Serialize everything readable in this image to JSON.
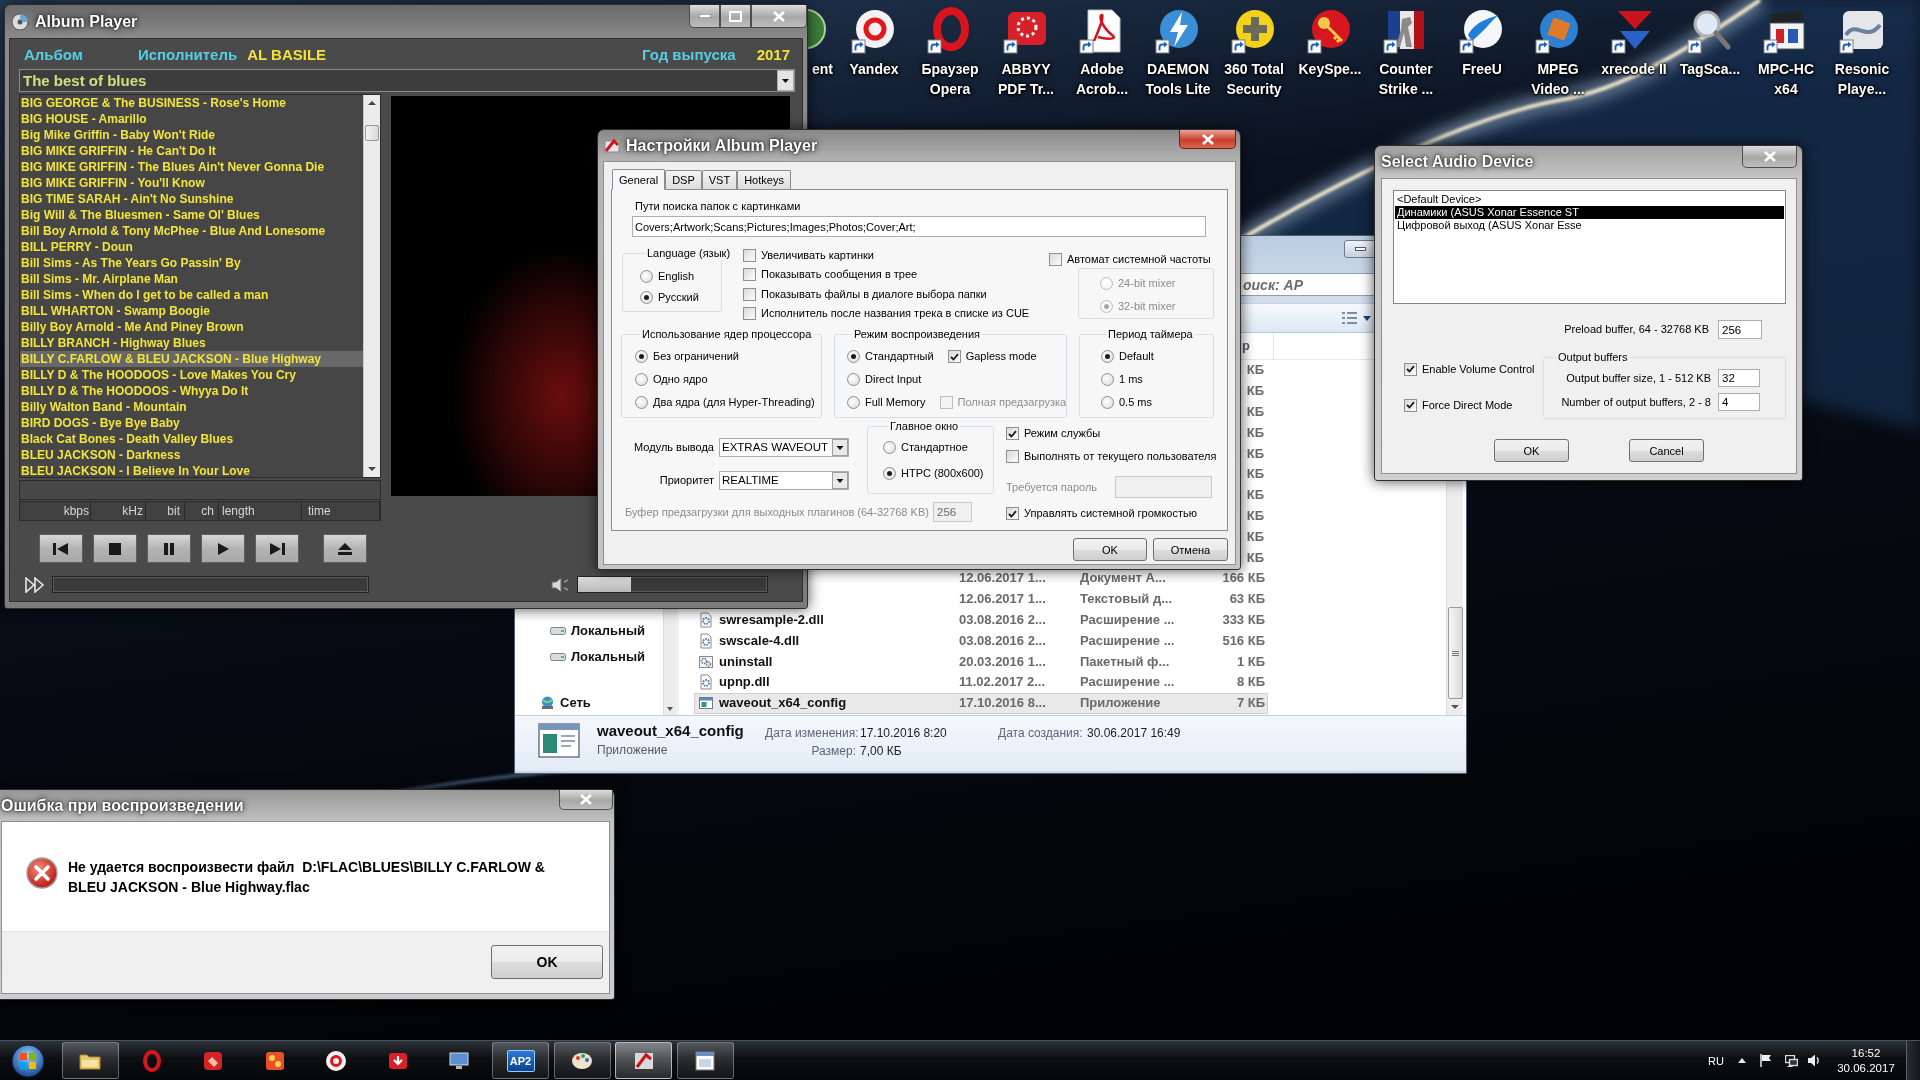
{
  "album_player": {
    "title": "Album Player",
    "album_label": "Альбом",
    "artist_label": "Исполнитель",
    "artist": "AL BASILE",
    "year_label": "Год выпуска",
    "year": "2017",
    "album": "The best of blues",
    "tracks": [
      {
        "title": "BIG GEORGE & The BUSINESS - Rose's Home",
        "selected": false
      },
      {
        "title": "BIG HOUSE - Amarillo",
        "selected": false
      },
      {
        "title": "Big Mike Griffin - Baby Won't Ride",
        "selected": false
      },
      {
        "title": "BIG MIKE GRIFFIN - He Can't Do It",
        "selected": false
      },
      {
        "title": "BIG MIKE GRIFFIN - The Blues Ain't Never Gonna Die",
        "selected": false
      },
      {
        "title": "BIG MIKE GRIFFIN - You'll Know",
        "selected": false
      },
      {
        "title": "BIG TIME SARAH - Ain't No Sunshine",
        "selected": false
      },
      {
        "title": "Big Will & The Bluesmen - Same Ol' Blues",
        "selected": false
      },
      {
        "title": "Bill Boy Arnold & Tony McPhee - Blue And Lonesome",
        "selected": false
      },
      {
        "title": "BILL PERRY - Doun",
        "selected": false
      },
      {
        "title": "Bill Sims - As The Years Go Passin' By",
        "selected": false
      },
      {
        "title": "Bill Sims - Mr. Airplane Man",
        "selected": false
      },
      {
        "title": "Bill Sims - When do I get to be called a man",
        "selected": false
      },
      {
        "title": "BILL WHARTON - Swamp Boogie",
        "selected": false
      },
      {
        "title": "Billy Boy Arnold - Me And Piney Brown",
        "selected": false
      },
      {
        "title": "BILLY BRANCH - Highway Blues",
        "selected": false
      },
      {
        "title": "BILLY C.FARLOW & BLEU JACKSON - Blue Highway",
        "selected": true
      },
      {
        "title": "BILLY D & The HOODOOS - Love Makes You Cry",
        "selected": false
      },
      {
        "title": "BILLY D & The HOODOOS - Whyya Do It",
        "selected": false
      },
      {
        "title": "Billy Walton Band - Mountain",
        "selected": false
      },
      {
        "title": "BIRD DOGS - Bye Bye Baby",
        "selected": false
      },
      {
        "title": "Black Cat Bones - Death Valley Blues",
        "selected": false
      },
      {
        "title": "BLEU JACKSON - Darkness",
        "selected": false
      },
      {
        "title": "BLEU JACKSON - I Believe In Your Love",
        "selected": false
      }
    ],
    "columns": [
      "kbps",
      "kHz",
      "bit",
      "ch",
      "length",
      "time"
    ],
    "volume": {
      "level": 0.28
    }
  },
  "desktop": {
    "icons": [
      {
        "kind": "partial",
        "label": "ent"
      },
      {
        "kind": "yandex",
        "label": "Yandex"
      },
      {
        "kind": "opera",
        "label": "Браузер\nOpera"
      },
      {
        "kind": "abbyy",
        "label": "ABBYY\nPDF Tr..."
      },
      {
        "kind": "acrobat",
        "label": "Adobe\nAcrob..."
      },
      {
        "kind": "daemon",
        "label": "DAEMON\nTools Lite"
      },
      {
        "kind": "security",
        "label": "360 Total\nSecurity"
      },
      {
        "kind": "keyspeed",
        "label": "KeySpe..."
      },
      {
        "kind": "counterstrike",
        "label": "Counter\nStrike ..."
      },
      {
        "kind": "freeu",
        "label": "FreeU"
      },
      {
        "kind": "mpeg",
        "label": "MPEG\nVideo ..."
      },
      {
        "kind": "xrecode",
        "label": "xrecode II"
      },
      {
        "kind": "tagscanner",
        "label": "TagSca..."
      },
      {
        "kind": "mpchc",
        "label": "MPC-HC\nx64"
      },
      {
        "kind": "resonic",
        "label": "Resonic\nPlaye..."
      }
    ]
  },
  "settings": {
    "title": "Настройки Album Player",
    "tabs": [
      {
        "label": "General",
        "selected": true
      },
      {
        "label": "DSP",
        "selected": false
      },
      {
        "label": "VST",
        "selected": false
      },
      {
        "label": "Hotkeys",
        "selected": false
      }
    ],
    "paths": {
      "label": "Пути поиска папок с картинками",
      "value": "Covers;Artwork;Scans;Pictures;Images;Photos;Cover;Art;"
    },
    "language": {
      "title": "Language (язык)",
      "options": [
        {
          "label": "English",
          "selected": false
        },
        {
          "label": "Русский",
          "selected": true
        }
      ]
    },
    "options": [
      {
        "label": "Увеличивать картинки",
        "checked": false
      },
      {
        "label": "Показывать сообщения в трее",
        "checked": false
      },
      {
        "label": "Показывать файлы в диалоге выбора папки",
        "checked": false
      },
      {
        "label": "Исполнитель после названия трека в списке из CUE",
        "checked": false
      }
    ],
    "auto_frequency": {
      "label": "Автомат системной частоты",
      "checked": false
    },
    "mixer": {
      "disabled": true,
      "options": [
        {
          "label": "24-bit mixer",
          "selected": false
        },
        {
          "label": "32-bit mixer",
          "selected": true
        }
      ]
    },
    "cpu": {
      "title": "Использование ядер процессора",
      "options": [
        {
          "label": "Без ограничений",
          "selected": true
        },
        {
          "label": "Одно ядро",
          "selected": false
        },
        {
          "label": "Два ядра (для Hyper-Threading)",
          "selected": false
        }
      ]
    },
    "playback": {
      "title": "Режим воспроизведения",
      "options": [
        {
          "label": "Стандартный",
          "selected": true,
          "extra": {
            "label": "Gapless mode",
            "checked": true,
            "disabled": false
          }
        },
        {
          "label": "Direct Input",
          "selected": false
        },
        {
          "label": "Full Memory",
          "selected": false,
          "extra": {
            "label": "Полная предзагрузка",
            "checked": false,
            "disabled": true
          }
        }
      ]
    },
    "timer": {
      "title": "Период таймера",
      "options": [
        {
          "label": "Default",
          "selected": true
        },
        {
          "label": "1 ms",
          "selected": false
        },
        {
          "label": "0.5 ms",
          "selected": false
        }
      ]
    },
    "output_module": {
      "label": "Модуль вывода",
      "value": "EXTRAS WAVEOUT"
    },
    "priority": {
      "label": "Приоритет",
      "value": "REALTIME"
    },
    "main_window": {
      "title": "Главное окно",
      "options": [
        {
          "label": "Стандартное",
          "selected": false
        },
        {
          "label": "HTPC (800x600)",
          "selected": true
        }
      ]
    },
    "service": [
      {
        "label": "Режим службы",
        "checked": true
      },
      {
        "label": "Выполнять от текущего пользователя",
        "checked": false
      }
    ],
    "password": {
      "label": "Требуется пароль",
      "disabled": true
    },
    "buffer": {
      "label": "Буфер предзагрузки для выходных плагинов (64-32768 KB)",
      "value": "256",
      "disabled": true
    },
    "system_volume": {
      "label": "Управлять системной громкостью",
      "checked": true
    },
    "buttons": [
      "OK",
      "Отмена"
    ]
  },
  "audio_device": {
    "title": "Select Audio Device",
    "devices": [
      {
        "label": "<Default Device>",
        "selected": false
      },
      {
        "label": "Динамики (ASUS Xonar Essence ST",
        "selected": true
      },
      {
        "label": "Цифровой выход (ASUS Xonar Esse",
        "selected": false
      }
    ],
    "preload": {
      "label": "Preload buffer, 64 - 32768 KB",
      "value": "256"
    },
    "checks": [
      {
        "label": "Enable Volume Control",
        "checked": true
      },
      {
        "label": "Force Direct Mode",
        "checked": true
      }
    ],
    "output_buffers": {
      "title": "Output buffers",
      "fields": [
        {
          "label": "Output buffer size, 1 - 512 KB",
          "value": "32"
        },
        {
          "label": "Number of output buffers, 2 - 8",
          "value": "4"
        }
      ]
    },
    "buttons": [
      "OK",
      "Cancel"
    ]
  },
  "explorer": {
    "search": {
      "placeholder": "оиск: AP"
    },
    "size_header": "р",
    "nav": [
      {
        "kind": "drive",
        "label": "Локальный"
      },
      {
        "kind": "drive",
        "label": "Локальный"
      },
      {
        "kind": "network",
        "label": "Сеть"
      }
    ],
    "hidden_sizes": [
      "КБ",
      "КБ",
      "КБ",
      "КБ",
      "КБ",
      "КБ",
      "КБ",
      "КБ",
      "КБ",
      "КБ"
    ],
    "files": [
      {
        "date": "12.06.2017 1...",
        "type": "Документ А...",
        "size": "166 КБ",
        "selected": false
      },
      {
        "date": "12.06.2017 1...",
        "type": "Текстовый д...",
        "size": "63 КБ",
        "selected": false
      },
      {
        "kind": "dll",
        "name": "swresample-2.dll",
        "date": "03.08.2016 2...",
        "type": "Расширение ...",
        "size": "333 КБ",
        "selected": false
      },
      {
        "kind": "dll",
        "name": "swscale-4.dll",
        "date": "03.08.2016 2...",
        "type": "Расширение ...",
        "size": "516 КБ",
        "selected": false
      },
      {
        "kind": "batch",
        "name": "uninstall",
        "date": "20.03.2016 1...",
        "type": "Пакетный ф...",
        "size": "1 КБ",
        "selected": false
      },
      {
        "kind": "dll",
        "name": "upnp.dll",
        "date": "11.02.2017 2...",
        "type": "Расширение ...",
        "size": "8 КБ",
        "selected": false
      },
      {
        "kind": "app",
        "name": "waveout_x64_config",
        "date": "17.10.2016 8...",
        "type": "Приложение",
        "size": "7 КБ",
        "selected": true
      }
    ],
    "details": {
      "name": "waveout_x64_config",
      "type": "Приложение",
      "modified_label": "Дата изменения:",
      "modified": "17.10.2016 8:20",
      "created_label": "Дата создания:",
      "created": "30.06.2017 16:49",
      "size_label": "Размер:",
      "size": "7,00 КБ"
    }
  },
  "error_dialog": {
    "title": "Ошибка при воспроизведении",
    "message": "Не удается воспроизвести файл  D:\\FLAC\\BLUES\\BILLY C.FARLOW & BLEU JACKSON - Blue Highway.flac",
    "button": "OK"
  },
  "taskbar": {
    "apps": [
      {
        "kind": "explorer",
        "running": true,
        "selected": false
      },
      {
        "kind": "opera",
        "running": false,
        "selected": false
      },
      {
        "kind": "kingsoft",
        "running": false,
        "selected": false
      },
      {
        "kind": "orange",
        "running": false,
        "selected": false
      },
      {
        "kind": "yandex",
        "running": false,
        "selected": false
      },
      {
        "kind": "download",
        "running": false,
        "selected": false
      },
      {
        "kind": "monitor",
        "running": false,
        "selected": false
      },
      {
        "kind": "ap2",
        "label": "AP2",
        "running": true,
        "selected": false
      },
      {
        "kind": "paint",
        "running": true,
        "selected": false
      },
      {
        "kind": "albumplayer",
        "running": true,
        "selected": true
      },
      {
        "kind": "window",
        "running": true,
        "selected": false
      }
    ],
    "language": "RU",
    "time": "16:52",
    "date": "30.06.2017"
  }
}
